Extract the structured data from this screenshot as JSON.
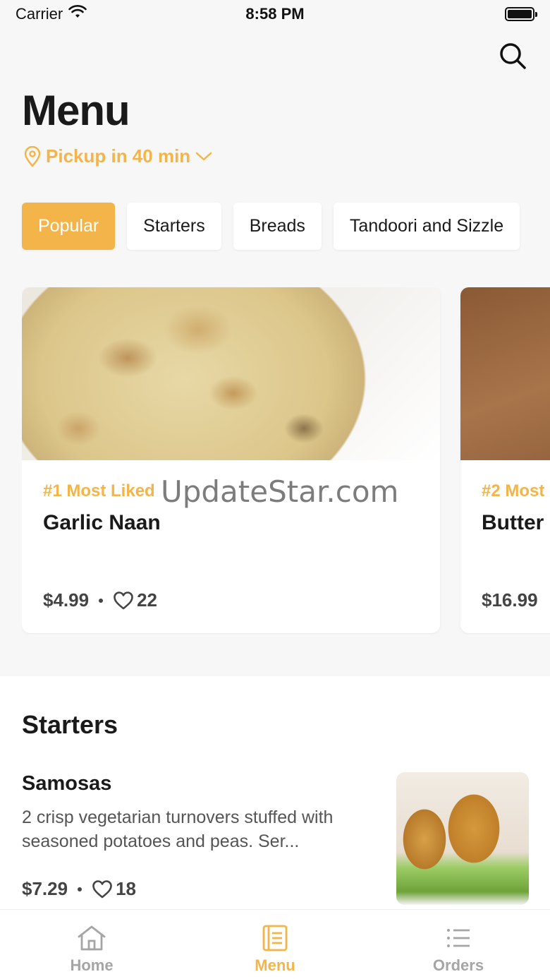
{
  "status": {
    "carrier": "Carrier",
    "time": "8:58 PM"
  },
  "page": {
    "title": "Menu"
  },
  "pickup": {
    "label": "Pickup in 40 min"
  },
  "chips": [
    {
      "label": "Popular",
      "active": true
    },
    {
      "label": "Starters",
      "active": false
    },
    {
      "label": "Breads",
      "active": false
    },
    {
      "label": "Tandoori and Sizzle",
      "active": false
    }
  ],
  "cards": [
    {
      "tag": "#1 Most Liked",
      "name": "Garlic Naan",
      "price": "$4.99",
      "likes": "22"
    },
    {
      "tag": "#2 Most",
      "name": "Butter",
      "price": "$16.99",
      "likes": ""
    }
  ],
  "watermark": "UpdateStar.com",
  "section": {
    "title": "Starters",
    "item": {
      "name": "Samosas",
      "description": "2 crisp vegetarian turnovers stuffed with seasoned potatoes and peas. Ser...",
      "price": "$7.29",
      "likes": "18"
    }
  },
  "tabs": [
    {
      "label": "Home",
      "icon": "home-icon"
    },
    {
      "label": "Menu",
      "icon": "menu-icon"
    },
    {
      "label": "Orders",
      "icon": "list-icon"
    }
  ],
  "colors": {
    "accent": "#f3b54a",
    "background": "#f7f7f7"
  }
}
